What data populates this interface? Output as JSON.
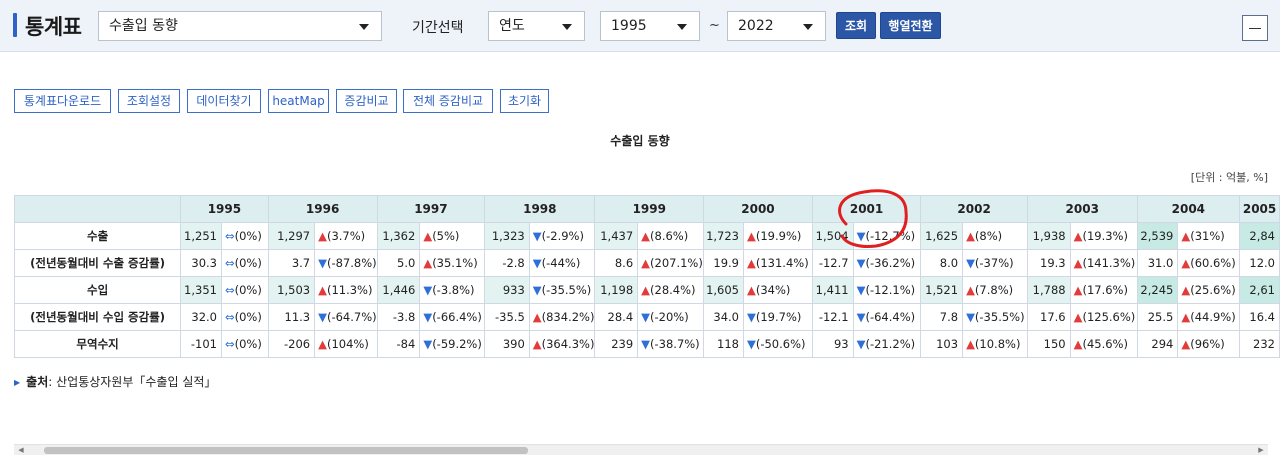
{
  "header": {
    "title": "통계표",
    "stat_select": "수출입 동향",
    "period_label": "기간선택",
    "period_unit": "연도",
    "start_year": "1995",
    "tilde": "~",
    "end_year": "2022",
    "query_button": "조회",
    "pivot_button": "행열전환",
    "minimize_symbol": "—"
  },
  "toolbar": {
    "download": "통계표다운로드",
    "settings": "조회설정",
    "find_data": "데이터찾기",
    "heatmap": "heatMap",
    "compare": "증감비교",
    "compare_all": "전체 증감비교",
    "reset": "초기화"
  },
  "table": {
    "title": "수출입 동향",
    "unit": "[단위 : 억불, %]",
    "years": [
      "1995",
      "1996",
      "1997",
      "1998",
      "1999",
      "2000",
      "2001",
      "2002",
      "2003",
      "2004",
      "2005"
    ],
    "rows": [
      {
        "label": "수출",
        "cells": [
          {
            "v": "1,251",
            "c": "⇔(0%)",
            "d": "flat"
          },
          {
            "v": "1,297",
            "c": "▲(3.7%)",
            "d": "up"
          },
          {
            "v": "1,362",
            "c": "▲(5%)",
            "d": "up"
          },
          {
            "v": "1,323",
            "c": "▼(-2.9%)",
            "d": "down"
          },
          {
            "v": "1,437",
            "c": "▲(8.6%)",
            "d": "up"
          },
          {
            "v": "1,723",
            "c": "▲(19.9%)",
            "d": "up"
          },
          {
            "v": "1,504",
            "c": "▼(-12.7%)",
            "d": "down"
          },
          {
            "v": "1,625",
            "c": "▲(8%)",
            "d": "up"
          },
          {
            "v": "1,938",
            "c": "▲(19.3%)",
            "d": "up"
          },
          {
            "v": "2,539",
            "c": "▲(31%)",
            "d": "up"
          },
          {
            "v": "2,84",
            "c": "",
            "d": "up"
          }
        ]
      },
      {
        "label": "(전년동월대비 수출 증감률)",
        "cells": [
          {
            "v": "30.3",
            "c": "⇔(0%)",
            "d": "flat"
          },
          {
            "v": "3.7",
            "c": "▼(-87.8%)",
            "d": "down"
          },
          {
            "v": "5.0",
            "c": "▲(35.1%)",
            "d": "up"
          },
          {
            "v": "-2.8",
            "c": "▼(-44%)",
            "d": "down"
          },
          {
            "v": "8.6",
            "c": "▲(207.1%)",
            "d": "up"
          },
          {
            "v": "19.9",
            "c": "▲(131.4%)",
            "d": "up"
          },
          {
            "v": "-12.7",
            "c": "▼(-36.2%)",
            "d": "down"
          },
          {
            "v": "8.0",
            "c": "▼(-37%)",
            "d": "down"
          },
          {
            "v": "19.3",
            "c": "▲(141.3%)",
            "d": "up"
          },
          {
            "v": "31.0",
            "c": "▲(60.6%)",
            "d": "up"
          },
          {
            "v": "12.0",
            "c": "",
            "d": "up"
          }
        ]
      },
      {
        "label": "수입",
        "cells": [
          {
            "v": "1,351",
            "c": "⇔(0%)",
            "d": "flat"
          },
          {
            "v": "1,503",
            "c": "▲(11.3%)",
            "d": "up"
          },
          {
            "v": "1,446",
            "c": "▼(-3.8%)",
            "d": "down"
          },
          {
            "v": "933",
            "c": "▼(-35.5%)",
            "d": "down"
          },
          {
            "v": "1,198",
            "c": "▲(28.4%)",
            "d": "up"
          },
          {
            "v": "1,605",
            "c": "▲(34%)",
            "d": "up"
          },
          {
            "v": "1,411",
            "c": "▼(-12.1%)",
            "d": "down"
          },
          {
            "v": "1,521",
            "c": "▲(7.8%)",
            "d": "up"
          },
          {
            "v": "1,788",
            "c": "▲(17.6%)",
            "d": "up"
          },
          {
            "v": "2,245",
            "c": "▲(25.6%)",
            "d": "up"
          },
          {
            "v": "2,61",
            "c": "",
            "d": "up"
          }
        ]
      },
      {
        "label": "(전년동월대비 수입 증감률)",
        "cells": [
          {
            "v": "32.0",
            "c": "⇔(0%)",
            "d": "flat"
          },
          {
            "v": "11.3",
            "c": "▼(-64.7%)",
            "d": "down"
          },
          {
            "v": "-3.8",
            "c": "▼(-66.4%)",
            "d": "down"
          },
          {
            "v": "-35.5",
            "c": "▲(834.2%)",
            "d": "up"
          },
          {
            "v": "28.4",
            "c": "▼(-20%)",
            "d": "down"
          },
          {
            "v": "34.0",
            "c": "▼(19.7%)",
            "d": "down"
          },
          {
            "v": "-12.1",
            "c": "▼(-64.4%)",
            "d": "down"
          },
          {
            "v": "7.8",
            "c": "▼(-35.5%)",
            "d": "down"
          },
          {
            "v": "17.6",
            "c": "▲(125.6%)",
            "d": "up"
          },
          {
            "v": "25.5",
            "c": "▲(44.9%)",
            "d": "up"
          },
          {
            "v": "16.4",
            "c": "",
            "d": "up"
          }
        ]
      },
      {
        "label": "무역수지",
        "cells": [
          {
            "v": "-101",
            "c": "⇔(0%)",
            "d": "flat"
          },
          {
            "v": "-206",
            "c": "▲(104%)",
            "d": "up"
          },
          {
            "v": "-84",
            "c": "▼(-59.2%)",
            "d": "down"
          },
          {
            "v": "390",
            "c": "▲(364.3%)",
            "d": "up"
          },
          {
            "v": "239",
            "c": "▼(-38.7%)",
            "d": "down"
          },
          {
            "v": "118",
            "c": "▼(-50.6%)",
            "d": "down"
          },
          {
            "v": "93",
            "c": "▼(-21.2%)",
            "d": "down"
          },
          {
            "v": "103",
            "c": "▲(10.8%)",
            "d": "up"
          },
          {
            "v": "150",
            "c": "▲(45.6%)",
            "d": "up"
          },
          {
            "v": "294",
            "c": "▲(96%)",
            "d": "up"
          },
          {
            "v": "232",
            "c": "",
            "d": "up"
          }
        ]
      }
    ]
  },
  "source": {
    "label": "출처",
    "text": ": 산업통상자원부「수출입 실적」"
  },
  "colors": {
    "up": "#e23b3b",
    "down": "#2f6fd8",
    "header_bg": "#ddeef0",
    "cell_shade": "#e2f3f1",
    "button_dark": "#2c57a7",
    "annotation": "#e02020"
  }
}
